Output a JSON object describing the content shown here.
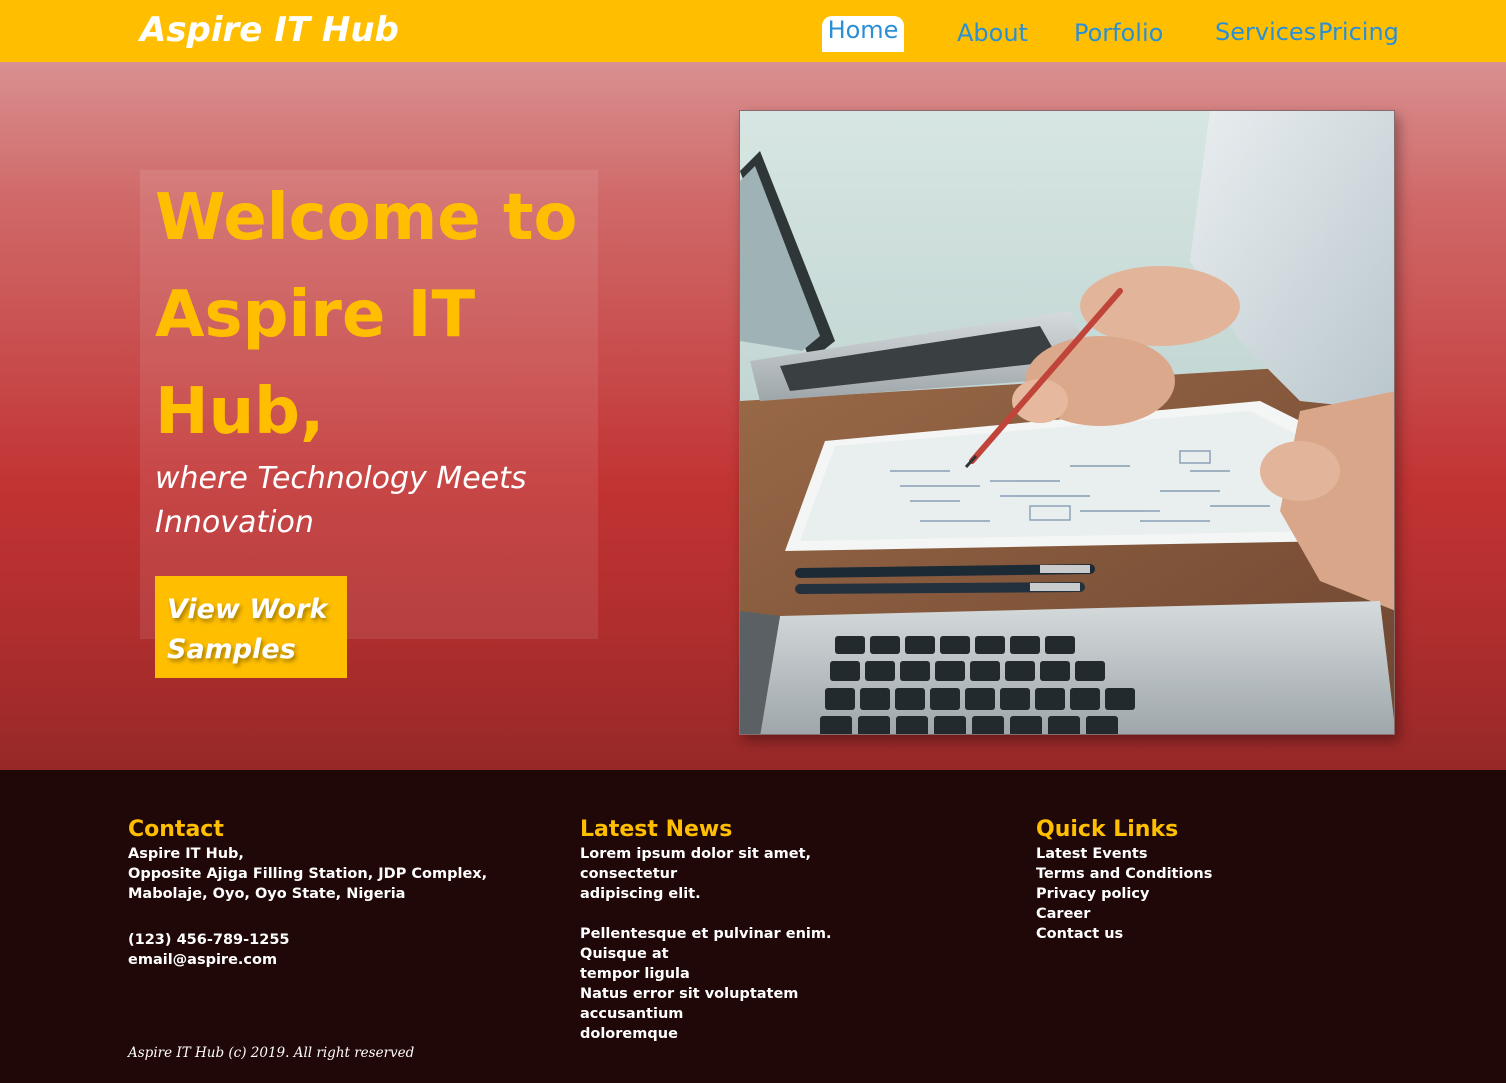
{
  "brand": "Aspire IT Hub",
  "nav": {
    "home": "Home",
    "about": "About",
    "portfolio": "Porfolio",
    "services": "Services",
    "pricing": "Pricing"
  },
  "hero": {
    "heading": "Welcome to Aspire IT Hub,",
    "subheading": "where Technology Meets Innovation",
    "button_line1": "View Work",
    "button_line2": "Samples"
  },
  "footer": {
    "contact": {
      "heading": "Contact",
      "address_line1": "Aspire IT Hub,",
      "address_line2": "Opposite Ajiga Filling Station, JDP Complex,",
      "address_line3": "Mabolaje, Oyo, Oyo State, Nigeria",
      "phone": "(123) 456-789-1255",
      "email": "email@aspire.com"
    },
    "news": {
      "heading": "Latest News",
      "item1_line1": "Lorem ipsum dolor sit amet, consectetur",
      "item1_line2": "adipiscing elit.",
      "item2_line1": "Pellentesque et pulvinar enim. Quisque at",
      "item2_line2": "tempor ligula",
      "item3_line1": "Natus error sit voluptatem accusantium",
      "item3_line2": "doloremque"
    },
    "links": {
      "heading": "Quick Links",
      "items": [
        "Latest Events",
        "Terms and Conditions",
        "Privacy policy",
        "Career",
        "Contact us"
      ]
    },
    "copyright": "Aspire IT Hub (c) 2019. All right reserved"
  },
  "colors": {
    "accent": "#ffbf00",
    "nav_link": "#2b8fd6",
    "hero_red": "#c23333",
    "footer_bg": "#210808"
  }
}
